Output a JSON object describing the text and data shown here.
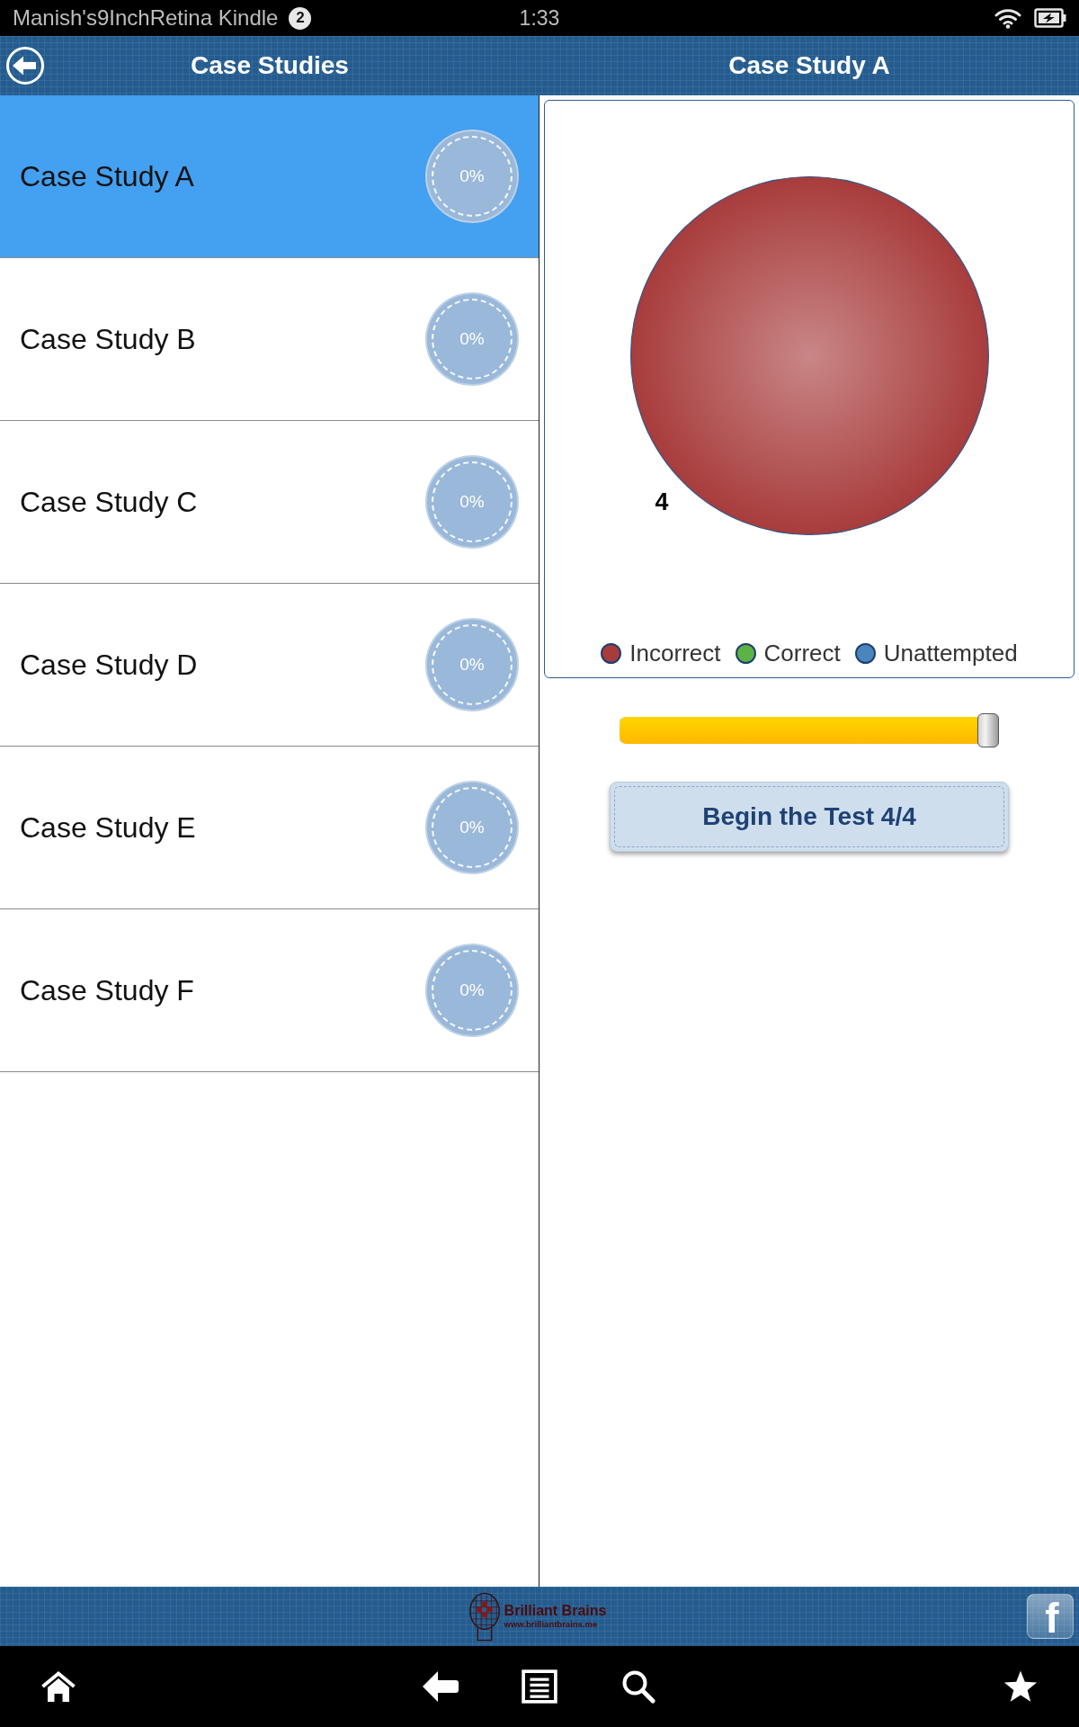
{
  "status_bar": {
    "device_name": "Manish's9InchRetina Kindle",
    "notification_count": "2",
    "time": "1:33"
  },
  "header": {
    "list_title": "Case Studies",
    "detail_title": "Case Study A"
  },
  "case_studies": [
    {
      "label": "Case Study A",
      "progress": "0%",
      "selected": true
    },
    {
      "label": "Case Study B",
      "progress": "0%",
      "selected": false
    },
    {
      "label": "Case Study C",
      "progress": "0%",
      "selected": false
    },
    {
      "label": "Case Study D",
      "progress": "0%",
      "selected": false
    },
    {
      "label": "Case Study E",
      "progress": "0%",
      "selected": false
    },
    {
      "label": "Case Study F",
      "progress": "0%",
      "selected": false
    }
  ],
  "chart": {
    "chart_data": {
      "type": "pie",
      "categories": [
        "Incorrect",
        "Correct",
        "Unattempted"
      ],
      "values": [
        4,
        0,
        0
      ],
      "data_labels": true
    },
    "legend": [
      {
        "color": "#a83c3c"
      },
      {
        "color": "#5db245"
      },
      {
        "color": "#4a86bd"
      }
    ]
  },
  "slider": {
    "level": 1
  },
  "begin_button": {
    "label": "Begin the Test 4/4"
  },
  "footer": {
    "brand_name": "Brilliant Brains",
    "brand_url": "www.brilliantbrains.me",
    "facebook_label": "f"
  }
}
